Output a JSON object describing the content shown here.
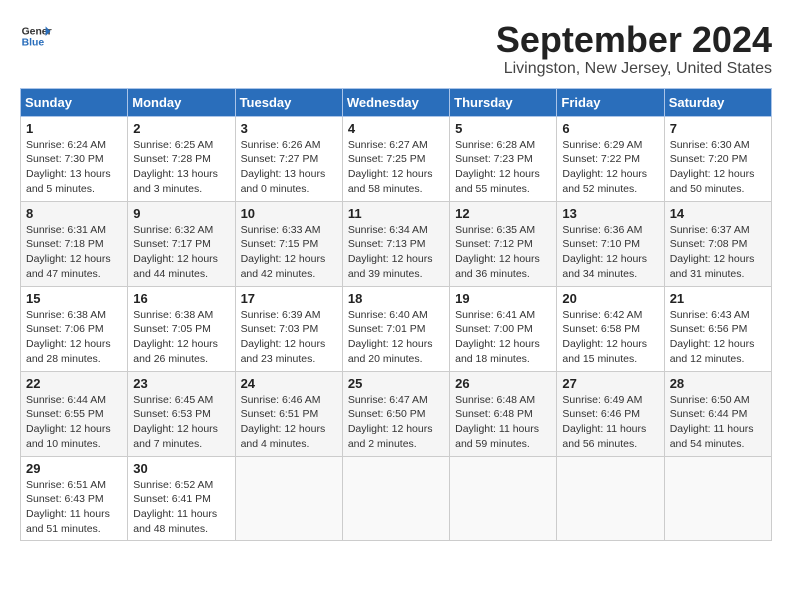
{
  "header": {
    "logo_line1": "General",
    "logo_line2": "Blue",
    "month_year": "September 2024",
    "location": "Livingston, New Jersey, United States"
  },
  "days_of_week": [
    "Sunday",
    "Monday",
    "Tuesday",
    "Wednesday",
    "Thursday",
    "Friday",
    "Saturday"
  ],
  "weeks": [
    [
      {
        "day": "1",
        "info": "Sunrise: 6:24 AM\nSunset: 7:30 PM\nDaylight: 13 hours\nand 5 minutes."
      },
      {
        "day": "2",
        "info": "Sunrise: 6:25 AM\nSunset: 7:28 PM\nDaylight: 13 hours\nand 3 minutes."
      },
      {
        "day": "3",
        "info": "Sunrise: 6:26 AM\nSunset: 7:27 PM\nDaylight: 13 hours\nand 0 minutes."
      },
      {
        "day": "4",
        "info": "Sunrise: 6:27 AM\nSunset: 7:25 PM\nDaylight: 12 hours\nand 58 minutes."
      },
      {
        "day": "5",
        "info": "Sunrise: 6:28 AM\nSunset: 7:23 PM\nDaylight: 12 hours\nand 55 minutes."
      },
      {
        "day": "6",
        "info": "Sunrise: 6:29 AM\nSunset: 7:22 PM\nDaylight: 12 hours\nand 52 minutes."
      },
      {
        "day": "7",
        "info": "Sunrise: 6:30 AM\nSunset: 7:20 PM\nDaylight: 12 hours\nand 50 minutes."
      }
    ],
    [
      {
        "day": "8",
        "info": "Sunrise: 6:31 AM\nSunset: 7:18 PM\nDaylight: 12 hours\nand 47 minutes."
      },
      {
        "day": "9",
        "info": "Sunrise: 6:32 AM\nSunset: 7:17 PM\nDaylight: 12 hours\nand 44 minutes."
      },
      {
        "day": "10",
        "info": "Sunrise: 6:33 AM\nSunset: 7:15 PM\nDaylight: 12 hours\nand 42 minutes."
      },
      {
        "day": "11",
        "info": "Sunrise: 6:34 AM\nSunset: 7:13 PM\nDaylight: 12 hours\nand 39 minutes."
      },
      {
        "day": "12",
        "info": "Sunrise: 6:35 AM\nSunset: 7:12 PM\nDaylight: 12 hours\nand 36 minutes."
      },
      {
        "day": "13",
        "info": "Sunrise: 6:36 AM\nSunset: 7:10 PM\nDaylight: 12 hours\nand 34 minutes."
      },
      {
        "day": "14",
        "info": "Sunrise: 6:37 AM\nSunset: 7:08 PM\nDaylight: 12 hours\nand 31 minutes."
      }
    ],
    [
      {
        "day": "15",
        "info": "Sunrise: 6:38 AM\nSunset: 7:06 PM\nDaylight: 12 hours\nand 28 minutes."
      },
      {
        "day": "16",
        "info": "Sunrise: 6:38 AM\nSunset: 7:05 PM\nDaylight: 12 hours\nand 26 minutes."
      },
      {
        "day": "17",
        "info": "Sunrise: 6:39 AM\nSunset: 7:03 PM\nDaylight: 12 hours\nand 23 minutes."
      },
      {
        "day": "18",
        "info": "Sunrise: 6:40 AM\nSunset: 7:01 PM\nDaylight: 12 hours\nand 20 minutes."
      },
      {
        "day": "19",
        "info": "Sunrise: 6:41 AM\nSunset: 7:00 PM\nDaylight: 12 hours\nand 18 minutes."
      },
      {
        "day": "20",
        "info": "Sunrise: 6:42 AM\nSunset: 6:58 PM\nDaylight: 12 hours\nand 15 minutes."
      },
      {
        "day": "21",
        "info": "Sunrise: 6:43 AM\nSunset: 6:56 PM\nDaylight: 12 hours\nand 12 minutes."
      }
    ],
    [
      {
        "day": "22",
        "info": "Sunrise: 6:44 AM\nSunset: 6:55 PM\nDaylight: 12 hours\nand 10 minutes."
      },
      {
        "day": "23",
        "info": "Sunrise: 6:45 AM\nSunset: 6:53 PM\nDaylight: 12 hours\nand 7 minutes."
      },
      {
        "day": "24",
        "info": "Sunrise: 6:46 AM\nSunset: 6:51 PM\nDaylight: 12 hours\nand 4 minutes."
      },
      {
        "day": "25",
        "info": "Sunrise: 6:47 AM\nSunset: 6:50 PM\nDaylight: 12 hours\nand 2 minutes."
      },
      {
        "day": "26",
        "info": "Sunrise: 6:48 AM\nSunset: 6:48 PM\nDaylight: 11 hours\nand 59 minutes."
      },
      {
        "day": "27",
        "info": "Sunrise: 6:49 AM\nSunset: 6:46 PM\nDaylight: 11 hours\nand 56 minutes."
      },
      {
        "day": "28",
        "info": "Sunrise: 6:50 AM\nSunset: 6:44 PM\nDaylight: 11 hours\nand 54 minutes."
      }
    ],
    [
      {
        "day": "29",
        "info": "Sunrise: 6:51 AM\nSunset: 6:43 PM\nDaylight: 11 hours\nand 51 minutes."
      },
      {
        "day": "30",
        "info": "Sunrise: 6:52 AM\nSunset: 6:41 PM\nDaylight: 11 hours\nand 48 minutes."
      },
      {
        "day": "",
        "info": ""
      },
      {
        "day": "",
        "info": ""
      },
      {
        "day": "",
        "info": ""
      },
      {
        "day": "",
        "info": ""
      },
      {
        "day": "",
        "info": ""
      }
    ]
  ]
}
